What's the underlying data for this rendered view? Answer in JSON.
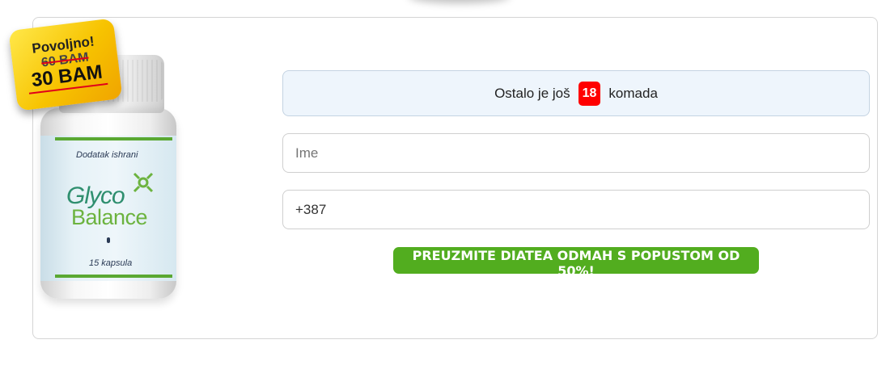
{
  "product": {
    "label_subtitle": "Dodatak ishrani",
    "brand_line1": "Glyco",
    "brand_line2": "Balance",
    "capsule_count": "15 kapsula"
  },
  "price_sticker": {
    "title": "Povoljno!",
    "old_price": "60 BAM",
    "new_price": "30 BAM"
  },
  "stock": {
    "prefix": "Ostalo je još",
    "count": "18",
    "suffix": "komada"
  },
  "form": {
    "name_placeholder": "Ime",
    "phone_value": "+387",
    "submit_label": "PREUZMITE DIATEA ODMAH S POPUSTOM OD 50%!"
  },
  "colors": {
    "cta": "#52ad1f",
    "badge": "#ff0000",
    "sticker": "#f7c300"
  }
}
